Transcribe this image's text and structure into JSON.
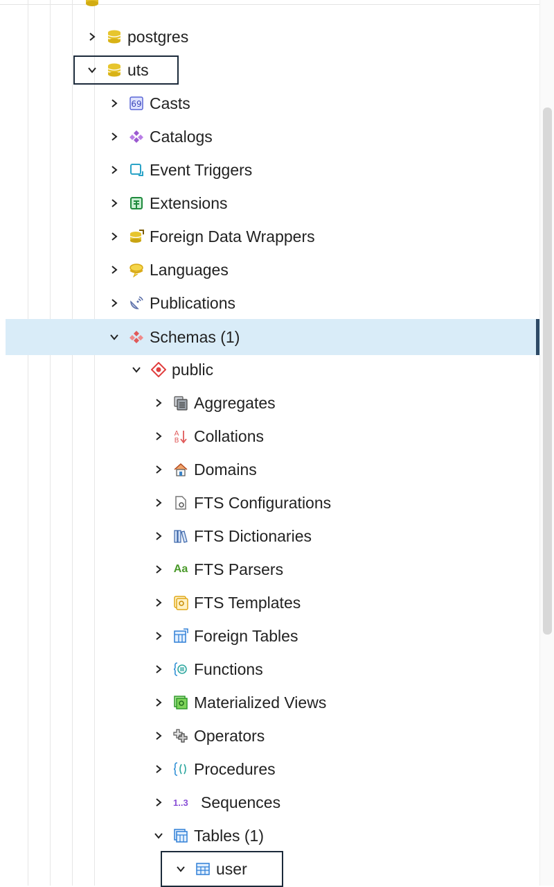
{
  "tree": {
    "servers": [
      {
        "label": "postgres",
        "expanded": false,
        "icon": "database-icon"
      },
      {
        "label": "uts",
        "expanded": true,
        "icon": "database-icon"
      }
    ],
    "database_children": [
      {
        "label": "Casts",
        "icon": "casts-icon"
      },
      {
        "label": "Catalogs",
        "icon": "catalogs-icon"
      },
      {
        "label": "Event Triggers",
        "icon": "event-triggers-icon"
      },
      {
        "label": "Extensions",
        "icon": "extensions-icon"
      },
      {
        "label": "Foreign Data Wrappers",
        "icon": "foreign-data-wrappers-icon"
      },
      {
        "label": "Languages",
        "icon": "languages-icon"
      },
      {
        "label": "Publications",
        "icon": "publications-icon"
      },
      {
        "label": "Schemas (1)",
        "icon": "schemas-icon",
        "expanded": true
      }
    ],
    "schema": {
      "label": "public",
      "icon": "schema-icon"
    },
    "schema_children": [
      {
        "label": "Aggregates",
        "icon": "aggregates-icon"
      },
      {
        "label": "Collations",
        "icon": "collations-icon"
      },
      {
        "label": "Domains",
        "icon": "domains-icon"
      },
      {
        "label": "FTS Configurations",
        "icon": "fts-configurations-icon"
      },
      {
        "label": "FTS Dictionaries",
        "icon": "fts-dictionaries-icon"
      },
      {
        "label": "FTS Parsers",
        "icon": "fts-parsers-icon",
        "glyph": "Aa"
      },
      {
        "label": "FTS Templates",
        "icon": "fts-templates-icon"
      },
      {
        "label": "Foreign Tables",
        "icon": "foreign-tables-icon"
      },
      {
        "label": "Functions",
        "icon": "functions-icon"
      },
      {
        "label": "Materialized Views",
        "icon": "materialized-views-icon"
      },
      {
        "label": "Operators",
        "icon": "operators-icon"
      },
      {
        "label": "Procedures",
        "icon": "procedures-icon"
      },
      {
        "label": "Sequences",
        "icon": "sequences-icon",
        "glyph": "1..3"
      },
      {
        "label": "Tables (1)",
        "icon": "tables-icon",
        "expanded": true
      }
    ],
    "table": {
      "label": "user",
      "icon": "table-icon"
    }
  },
  "colors": {
    "selected_row_bg": "#d9ecf8",
    "selected_row_bar": "#2e4a66",
    "focus_box": "#1b2a3a"
  }
}
